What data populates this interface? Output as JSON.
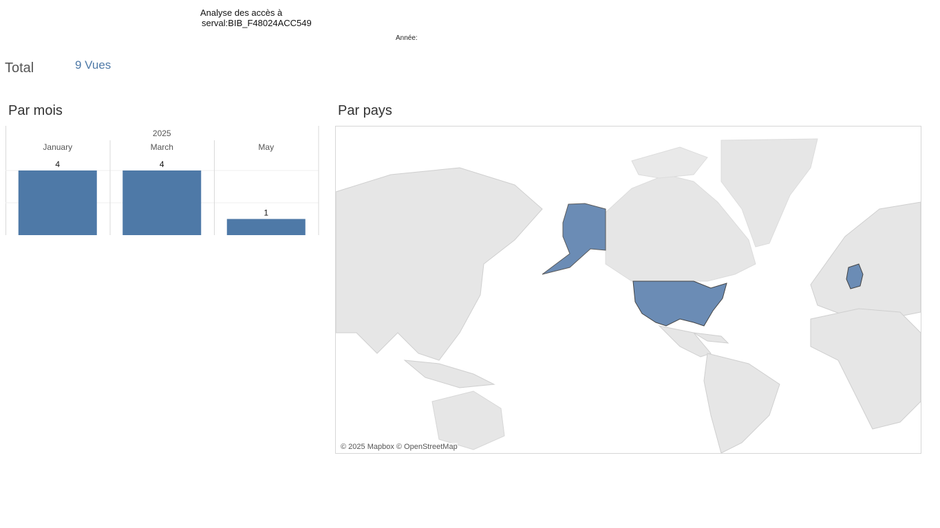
{
  "header": {
    "title_line1": "Analyse des accès à",
    "title_line2": "serval:BIB_F48024ACC549",
    "year_filter_label": "Année:"
  },
  "summary": {
    "total_label": "Total",
    "total_value": "9 Vues"
  },
  "sections": {
    "by_month_title": "Par mois",
    "by_country_title": "Par pays"
  },
  "map": {
    "attribution": "© 2025 Mapbox © OpenStreetMap",
    "highlighted_countries": [
      "Alaska (USA)",
      "United States",
      "Germany"
    ],
    "highlight_color": "#6b8cb5",
    "land_color": "#e6e6e6",
    "water_color": "#ffffff"
  },
  "colors": {
    "bar": "#4e79a7",
    "accent": "#4e79a7"
  },
  "chart_data": {
    "type": "bar",
    "group_header": "2025",
    "categories": [
      "January",
      "March",
      "May"
    ],
    "values": [
      4,
      4,
      1
    ],
    "ylim": [
      0,
      4
    ],
    "grid": true,
    "data_labels": true
  }
}
